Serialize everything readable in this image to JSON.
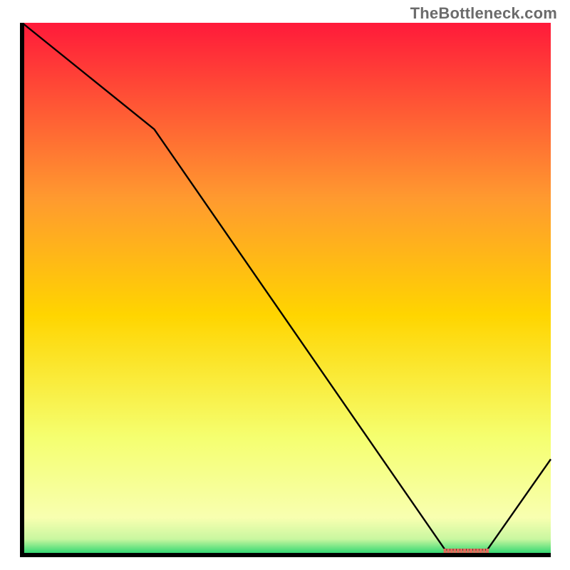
{
  "watermark": "TheBottleneck.com",
  "colors": {
    "top": "#ff1a3a",
    "mid1": "#ff7a2f",
    "mid2": "#ffd500",
    "mid3": "#f5ff70",
    "bottom_yellow": "#f8ffb0",
    "green": "#1fd46b",
    "line": "#000000",
    "axis": "#000000",
    "marker": "#e36a5c"
  },
  "chart_data": {
    "type": "line",
    "title": "",
    "xlabel": "",
    "ylabel": "",
    "xlim": [
      0,
      100
    ],
    "ylim": [
      0,
      100
    ],
    "x": [
      0,
      25,
      80,
      88,
      100
    ],
    "values": [
      100,
      80,
      1,
      1,
      18
    ],
    "marker_region": {
      "x_start": 80,
      "x_end": 88,
      "y": 0.8
    },
    "notes": "Gradient background from red (top) through orange/yellow to pale yellow with a thin green band at the bottom. Black curve descends from top-left, kinks near x≈25, bottoms out around x≈80–88, then rises toward the right edge. A short reddish dashed/hatched marker sits on the valley floor."
  }
}
